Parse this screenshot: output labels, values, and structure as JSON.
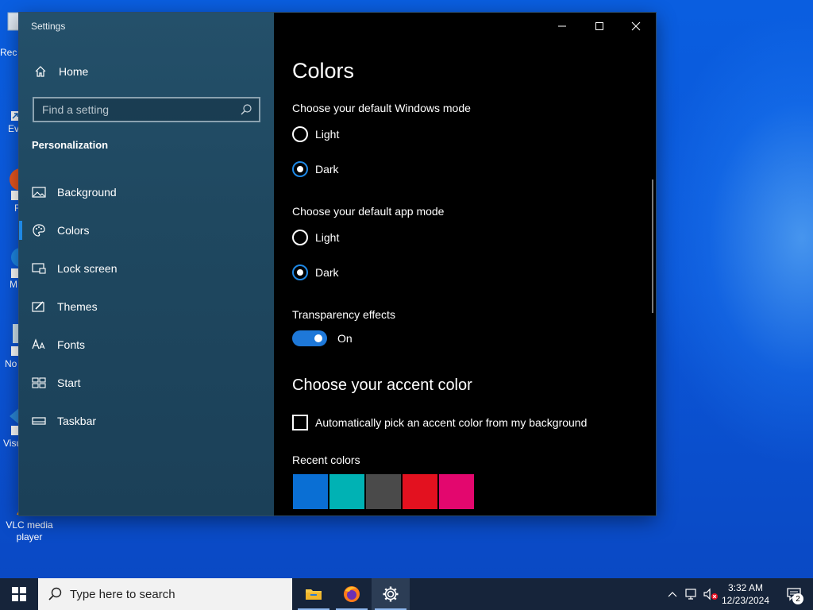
{
  "desktop": {
    "icons": [
      {
        "label": "Rec",
        "name": "recycle-bin"
      },
      {
        "label": "Ev",
        "name": "shortcut-ev"
      },
      {
        "label": "F",
        "name": "shortcut-f"
      },
      {
        "label": "M",
        "name": "shortcut-m"
      },
      {
        "label": "No",
        "name": "shortcut-no"
      },
      {
        "label": "Visu",
        "name": "shortcut-visu"
      }
    ],
    "vlc_label": "VLC media player"
  },
  "window": {
    "title": "Settings",
    "controls": {
      "minimize": "minimize-icon",
      "maximize": "maximize-icon",
      "close": "close-icon"
    }
  },
  "sidebar": {
    "home_label": "Home",
    "search_placeholder": "Find a setting",
    "section_title": "Personalization",
    "items": [
      {
        "label": "Background",
        "icon": "picture-icon"
      },
      {
        "label": "Colors",
        "icon": "palette-icon",
        "selected": true
      },
      {
        "label": "Lock screen",
        "icon": "lock-screen-icon"
      },
      {
        "label": "Themes",
        "icon": "themes-icon"
      },
      {
        "label": "Fonts",
        "icon": "fonts-icon"
      },
      {
        "label": "Start",
        "icon": "start-icon"
      },
      {
        "label": "Taskbar",
        "icon": "taskbar-icon"
      }
    ]
  },
  "content": {
    "title": "Colors",
    "windows_mode": {
      "label": "Choose your default Windows mode",
      "options": [
        "Light",
        "Dark"
      ],
      "selected": "Dark"
    },
    "app_mode": {
      "label": "Choose your default app mode",
      "options": [
        "Light",
        "Dark"
      ],
      "selected": "Dark"
    },
    "transparency": {
      "label": "Transparency effects",
      "state": "On",
      "enabled": true
    },
    "accent": {
      "title": "Choose your accent color",
      "auto_pick_label": "Automatically pick an accent color from my background",
      "auto_pick_checked": false,
      "recent_label": "Recent colors",
      "recent_colors": [
        "#0a6fd4",
        "#00b2b4",
        "#4a4a4a",
        "#e3111f",
        "#e3076e"
      ]
    }
  },
  "taskbar": {
    "search_placeholder": "Type here to search",
    "apps": [
      "file-explorer-icon",
      "firefox-icon",
      "settings-gear-icon"
    ],
    "time": "3:32 AM",
    "date": "12/23/2024",
    "notification_count": "2"
  }
}
